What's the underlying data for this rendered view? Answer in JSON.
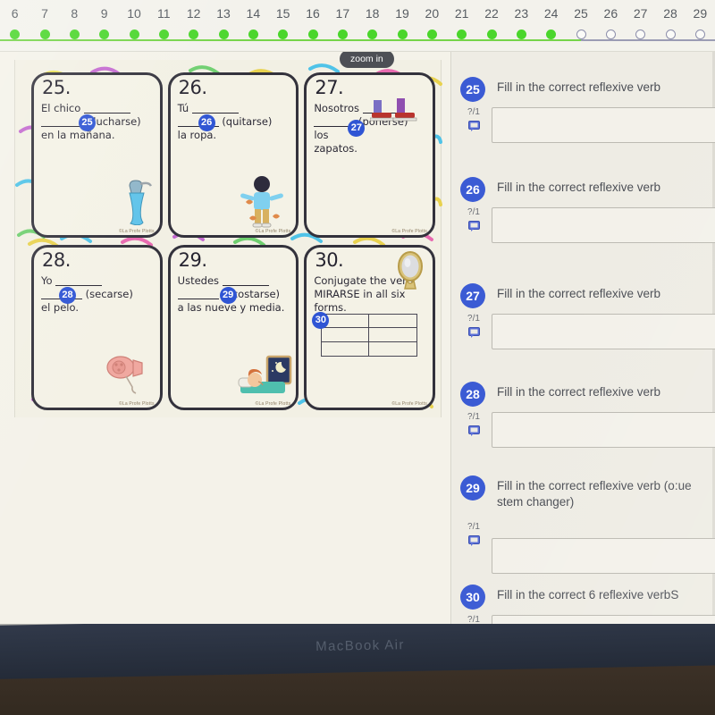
{
  "device": {
    "label": "MacBook Air"
  },
  "progress": {
    "items": [
      {
        "num": "6",
        "state": "done"
      },
      {
        "num": "7",
        "state": "done"
      },
      {
        "num": "8",
        "state": "done"
      },
      {
        "num": "9",
        "state": "done"
      },
      {
        "num": "10",
        "state": "done"
      },
      {
        "num": "11",
        "state": "done"
      },
      {
        "num": "12",
        "state": "done"
      },
      {
        "num": "13",
        "state": "done"
      },
      {
        "num": "14",
        "state": "done"
      },
      {
        "num": "15",
        "state": "done"
      },
      {
        "num": "16",
        "state": "done"
      },
      {
        "num": "17",
        "state": "done"
      },
      {
        "num": "18",
        "state": "done"
      },
      {
        "num": "19",
        "state": "done"
      },
      {
        "num": "20",
        "state": "done"
      },
      {
        "num": "21",
        "state": "done"
      },
      {
        "num": "22",
        "state": "done"
      },
      {
        "num": "23",
        "state": "done"
      },
      {
        "num": "24",
        "state": "done"
      },
      {
        "num": "25",
        "state": "todo"
      },
      {
        "num": "26",
        "state": "todo"
      },
      {
        "num": "27",
        "state": "todo"
      },
      {
        "num": "28",
        "state": "todo"
      },
      {
        "num": "29",
        "state": "todo"
      }
    ],
    "done_color": "#4ad62b",
    "todo_color": "#8d8fab"
  },
  "worksheet": {
    "zoom_tooltip": "zoom in",
    "credit": "©La Profe Plotts",
    "cards": [
      {
        "num": "25.",
        "badge": "25",
        "pre": "El chico",
        "paren": "(ducharse)",
        "post": "en la mañana.",
        "illustration": "shower-towel-icon"
      },
      {
        "num": "26.",
        "badge": "26",
        "pre": "Tú",
        "paren": "(quitarse)",
        "post": "la ropa.",
        "illustration": "boy-undressing-icon"
      },
      {
        "num": "27.",
        "badge": "27",
        "pre": "Nosotros",
        "paren": "(ponerse) los",
        "post": "zapatos.",
        "illustration": "shoes-icon"
      },
      {
        "num": "28.",
        "badge": "28",
        "pre": "Yo",
        "paren": "(secarse)",
        "post": "el pelo.",
        "illustration": "hair-dryer-icon"
      },
      {
        "num": "29.",
        "badge": "29",
        "pre": "Ustedes",
        "paren": "(acostarse)",
        "post": "a las nueve y media.",
        "illustration": "sleeping-person-icon"
      },
      {
        "num": "30.",
        "badge": "30",
        "pre": "Conjugate the verb",
        "paren": "MIRARSE in all six",
        "post": "forms.",
        "illustration": "mirror-icon"
      }
    ]
  },
  "answer_panel": {
    "score_label": "?/1",
    "comment_icon": "comment-bubble-icon",
    "badge_color": "#3b5bd4",
    "questions": [
      {
        "num": "25",
        "title": "Fill in the correct reflexive verb",
        "score": "?/1",
        "value": ""
      },
      {
        "num": "26",
        "title": "Fill in the correct reflexive verb",
        "score": "?/1",
        "value": ""
      },
      {
        "num": "27",
        "title": "Fill in the correct reflexive verb",
        "score": "?/1",
        "value": ""
      },
      {
        "num": "28",
        "title": "Fill in the correct reflexive verb",
        "score": "?/1",
        "value": ""
      },
      {
        "num": "29",
        "title": "Fill in the correct reflexive verb (o:ue stem changer)",
        "score": "?/1",
        "value": ""
      },
      {
        "num": "30",
        "title": "Fill in the correct 6 reflexive verbS",
        "score": "?/1",
        "value": ""
      }
    ]
  }
}
